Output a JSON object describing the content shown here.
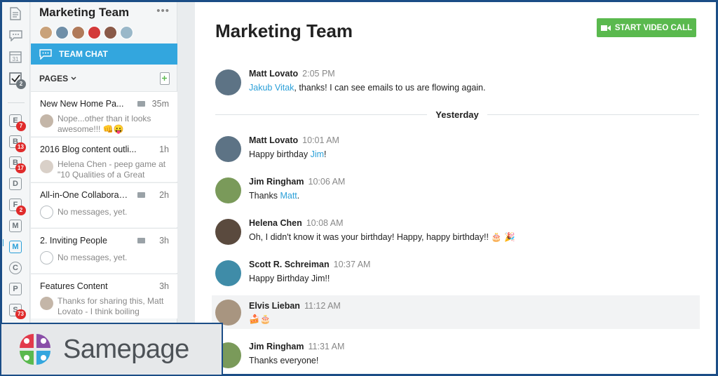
{
  "brand": {
    "name": "Samepage",
    "colors": {
      "red": "#e23a4b",
      "purple": "#8a4fa8",
      "green": "#5ab94e",
      "blue": "#33a6de"
    }
  },
  "rail": {
    "top_icons": [
      {
        "icon": "document-icon"
      },
      {
        "icon": "chat-bubble-icon"
      },
      {
        "icon": "calendar-icon",
        "label": "31"
      },
      {
        "icon": "tasks-check-icon",
        "badge": "2"
      }
    ],
    "spaces": [
      {
        "letter": "E",
        "badge": "7"
      },
      {
        "letter": "B",
        "badge": "13"
      },
      {
        "letter": "B",
        "badge": "17"
      },
      {
        "letter": "D",
        "badge": ""
      },
      {
        "letter": "F",
        "badge": "2"
      },
      {
        "letter": "M",
        "badge": ""
      },
      {
        "letter": "M",
        "badge": "",
        "active": true
      },
      {
        "letter": "C",
        "badge": ""
      },
      {
        "letter": "P",
        "badge": ""
      },
      {
        "letter": "S",
        "badge": "73"
      }
    ]
  },
  "team": {
    "title": "Marketing Team",
    "menu": "•••",
    "members": [
      {
        "color": "#c9a27a"
      },
      {
        "color": "#6f8fa8"
      },
      {
        "color": "#b07a5a"
      },
      {
        "color": "#d33a3a"
      },
      {
        "color": "#8a5a48"
      },
      {
        "color": "#9ab8c9"
      }
    ],
    "team_chat_label": "TEAM CHAT",
    "pages_label": "PAGES"
  },
  "pages": [
    {
      "title": "New New Home Pa...",
      "time": "35m",
      "preview": "Nope...other than it looks awesome!!! 👊😛",
      "avatar": "#c4b6a8",
      "folder": true
    },
    {
      "title": "2016 Blog content outli...",
      "time": "1h",
      "preview": "Helena Chen - peep game at \"10 Qualities of a Great",
      "avatar": "#d9d0c8",
      "folder": false
    },
    {
      "title": "All-in-One Collaborati...",
      "time": "2h",
      "preview": "No messages, yet.",
      "avatar": "",
      "folder": true
    },
    {
      "title": "2. Inviting People",
      "time": "3h",
      "preview": "No messages, yet.",
      "avatar": "",
      "folder": true
    },
    {
      "title": "Features Content",
      "time": "3h",
      "preview": "Thanks for sharing this, Matt Lovato - I think boiling",
      "avatar": "#c4b6a8",
      "folder": false
    }
  ],
  "chat": {
    "title": "Marketing Team",
    "video_button": "START VIDEO CALL",
    "divider_label": "Yesterday",
    "messages": [
      {
        "author": "Matt Lovato",
        "time": "2:05 PM",
        "mention": "Jakub Vitak",
        "text": ", thanks! I can see emails to us are flowing again.",
        "avatar": "#5d7385"
      },
      {
        "author": "Matt Lovato",
        "time": "10:01 AM",
        "prefix": "Happy birthday ",
        "mention": "Jim",
        "text": "!",
        "avatar": "#5d7385"
      },
      {
        "author": "Jim Ringham",
        "time": "10:06 AM",
        "prefix": "Thanks ",
        "mention": "Matt",
        "text": ".",
        "avatar": "#7a9a5a"
      },
      {
        "author": "Helena Chen",
        "time": "10:08 AM",
        "text": "Oh, I didn't know it was your birthday! Happy, happy birthday!! 🎂 🎉",
        "avatar": "#5a4a3e"
      },
      {
        "author": "Scott R. Schreiman",
        "time": "10:37 AM",
        "text": "Happy Birthday Jim!!",
        "avatar": "#3f8ca8"
      },
      {
        "author": "Elvis Lieban",
        "time": "11:12 AM",
        "text": "🍰🎂",
        "avatar": "#a89580"
      },
      {
        "author": "Jim Ringham",
        "time": "11:31 AM",
        "text": "Thanks everyone!",
        "avatar": "#7a9a5a"
      }
    ]
  }
}
